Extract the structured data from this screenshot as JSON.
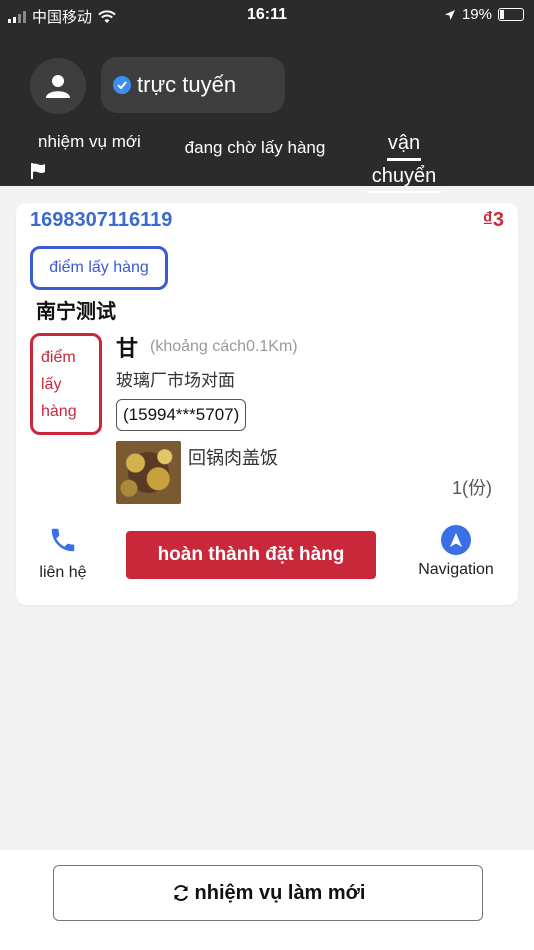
{
  "status_bar": {
    "carrier": "中国移动",
    "time": "16:11",
    "battery": "19%"
  },
  "header": {
    "online_label": "trực tuyến"
  },
  "tabs": [
    {
      "label": "nhiệm vụ mới"
    },
    {
      "label": "đang chờ lấy hàng"
    },
    {
      "label_line1": "vận",
      "label_line2": "chuyển"
    }
  ],
  "order": {
    "id": "1698307116119",
    "price": "₫3",
    "pickup_label": "điểm lấy hàng",
    "store_name": "南宁测试",
    "delivery_label": [
      "điểm",
      "lấy",
      "hàng"
    ],
    "customer_name": "甘",
    "distance": "(khoảng cách0.1Km)",
    "address": "玻璃厂市场对面",
    "phone": "(15994***5707)",
    "item_name": "回锅肉盖饭",
    "item_qty": "1(份)",
    "contact_label": "liên hệ",
    "complete_label": "hoàn thành đặt hàng",
    "navigation_label": "Navigation"
  },
  "footer": {
    "refresh_label": "nhiệm vụ làm mới"
  },
  "colors": {
    "header_bg": "#2b2b2b",
    "primary_blue": "#3a6bcc",
    "accent_red": "#c8283a"
  }
}
